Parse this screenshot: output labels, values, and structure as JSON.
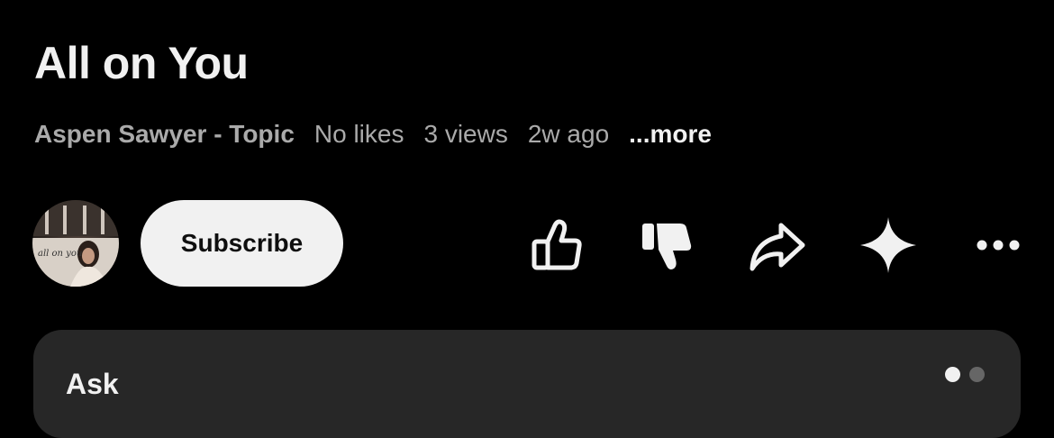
{
  "video": {
    "title": "All on You",
    "channel": "Aspen Sawyer - Topic",
    "likes": "No likes",
    "views": "3 views",
    "age": "2w ago",
    "more_label": "...more"
  },
  "actions": {
    "avatar_text": "all on you",
    "subscribe_label": "Subscribe",
    "icons": [
      "like-icon",
      "dislike-icon",
      "share-icon",
      "sparkle-icon",
      "more-options-icon"
    ]
  },
  "ask_card": {
    "label": "Ask",
    "page_count": 2,
    "active_page": 1
  },
  "colors": {
    "background": "#000000",
    "text_primary": "#f1f1f1",
    "text_secondary": "#aaaaaa",
    "card": "#272727",
    "subscribe_bg": "#f1f1f1"
  }
}
